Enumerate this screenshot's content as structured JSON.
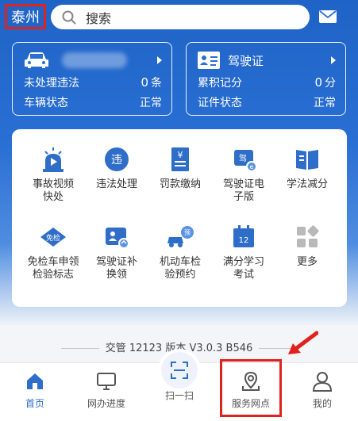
{
  "header": {
    "city": "泰州",
    "search_placeholder": "搜索"
  },
  "vehicle_card": {
    "r1_label": "未处理违法",
    "r1_value": "0",
    "r1_unit": "条",
    "r2_label": "车辆状态",
    "r2_value": "正常"
  },
  "license_card": {
    "title": "驾驶证",
    "r1_label": "累积记分",
    "r1_value": "0",
    "r1_unit": "分",
    "r2_label": "证件状态",
    "r2_value": "正常"
  },
  "services": [
    {
      "label": "事故视频\n快处",
      "icon": "accident-video-icon"
    },
    {
      "label": "违法处理",
      "icon": "violation-icon"
    },
    {
      "label": "罚款缴纳",
      "icon": "fine-payment-icon"
    },
    {
      "label": "驾驶证电\n子版",
      "icon": "e-license-icon"
    },
    {
      "label": "学法减分",
      "icon": "study-book-icon"
    },
    {
      "label": "免检车申领\n检验标志",
      "icon": "inspection-exempt-icon"
    },
    {
      "label": "驾驶证补\n换领",
      "icon": "license-replace-icon"
    },
    {
      "label": "机动车检\n验预约",
      "icon": "vehicle-inspection-icon"
    },
    {
      "label": "满分学习\n考试",
      "icon": "full-score-study-icon"
    },
    {
      "label": "更多",
      "icon": "more-grid-icon"
    }
  ],
  "version": "交管 12123 版本 V3.0.3 B546",
  "tabs": [
    {
      "label": "首页",
      "active": true
    },
    {
      "label": "网办进度"
    },
    {
      "label": "扫一扫"
    },
    {
      "label": "服务网点"
    },
    {
      "label": "我的"
    }
  ],
  "colors": {
    "primary": "#1f63c6",
    "highlight": "#e0221c",
    "icon_blue": "#2f6ec8"
  }
}
